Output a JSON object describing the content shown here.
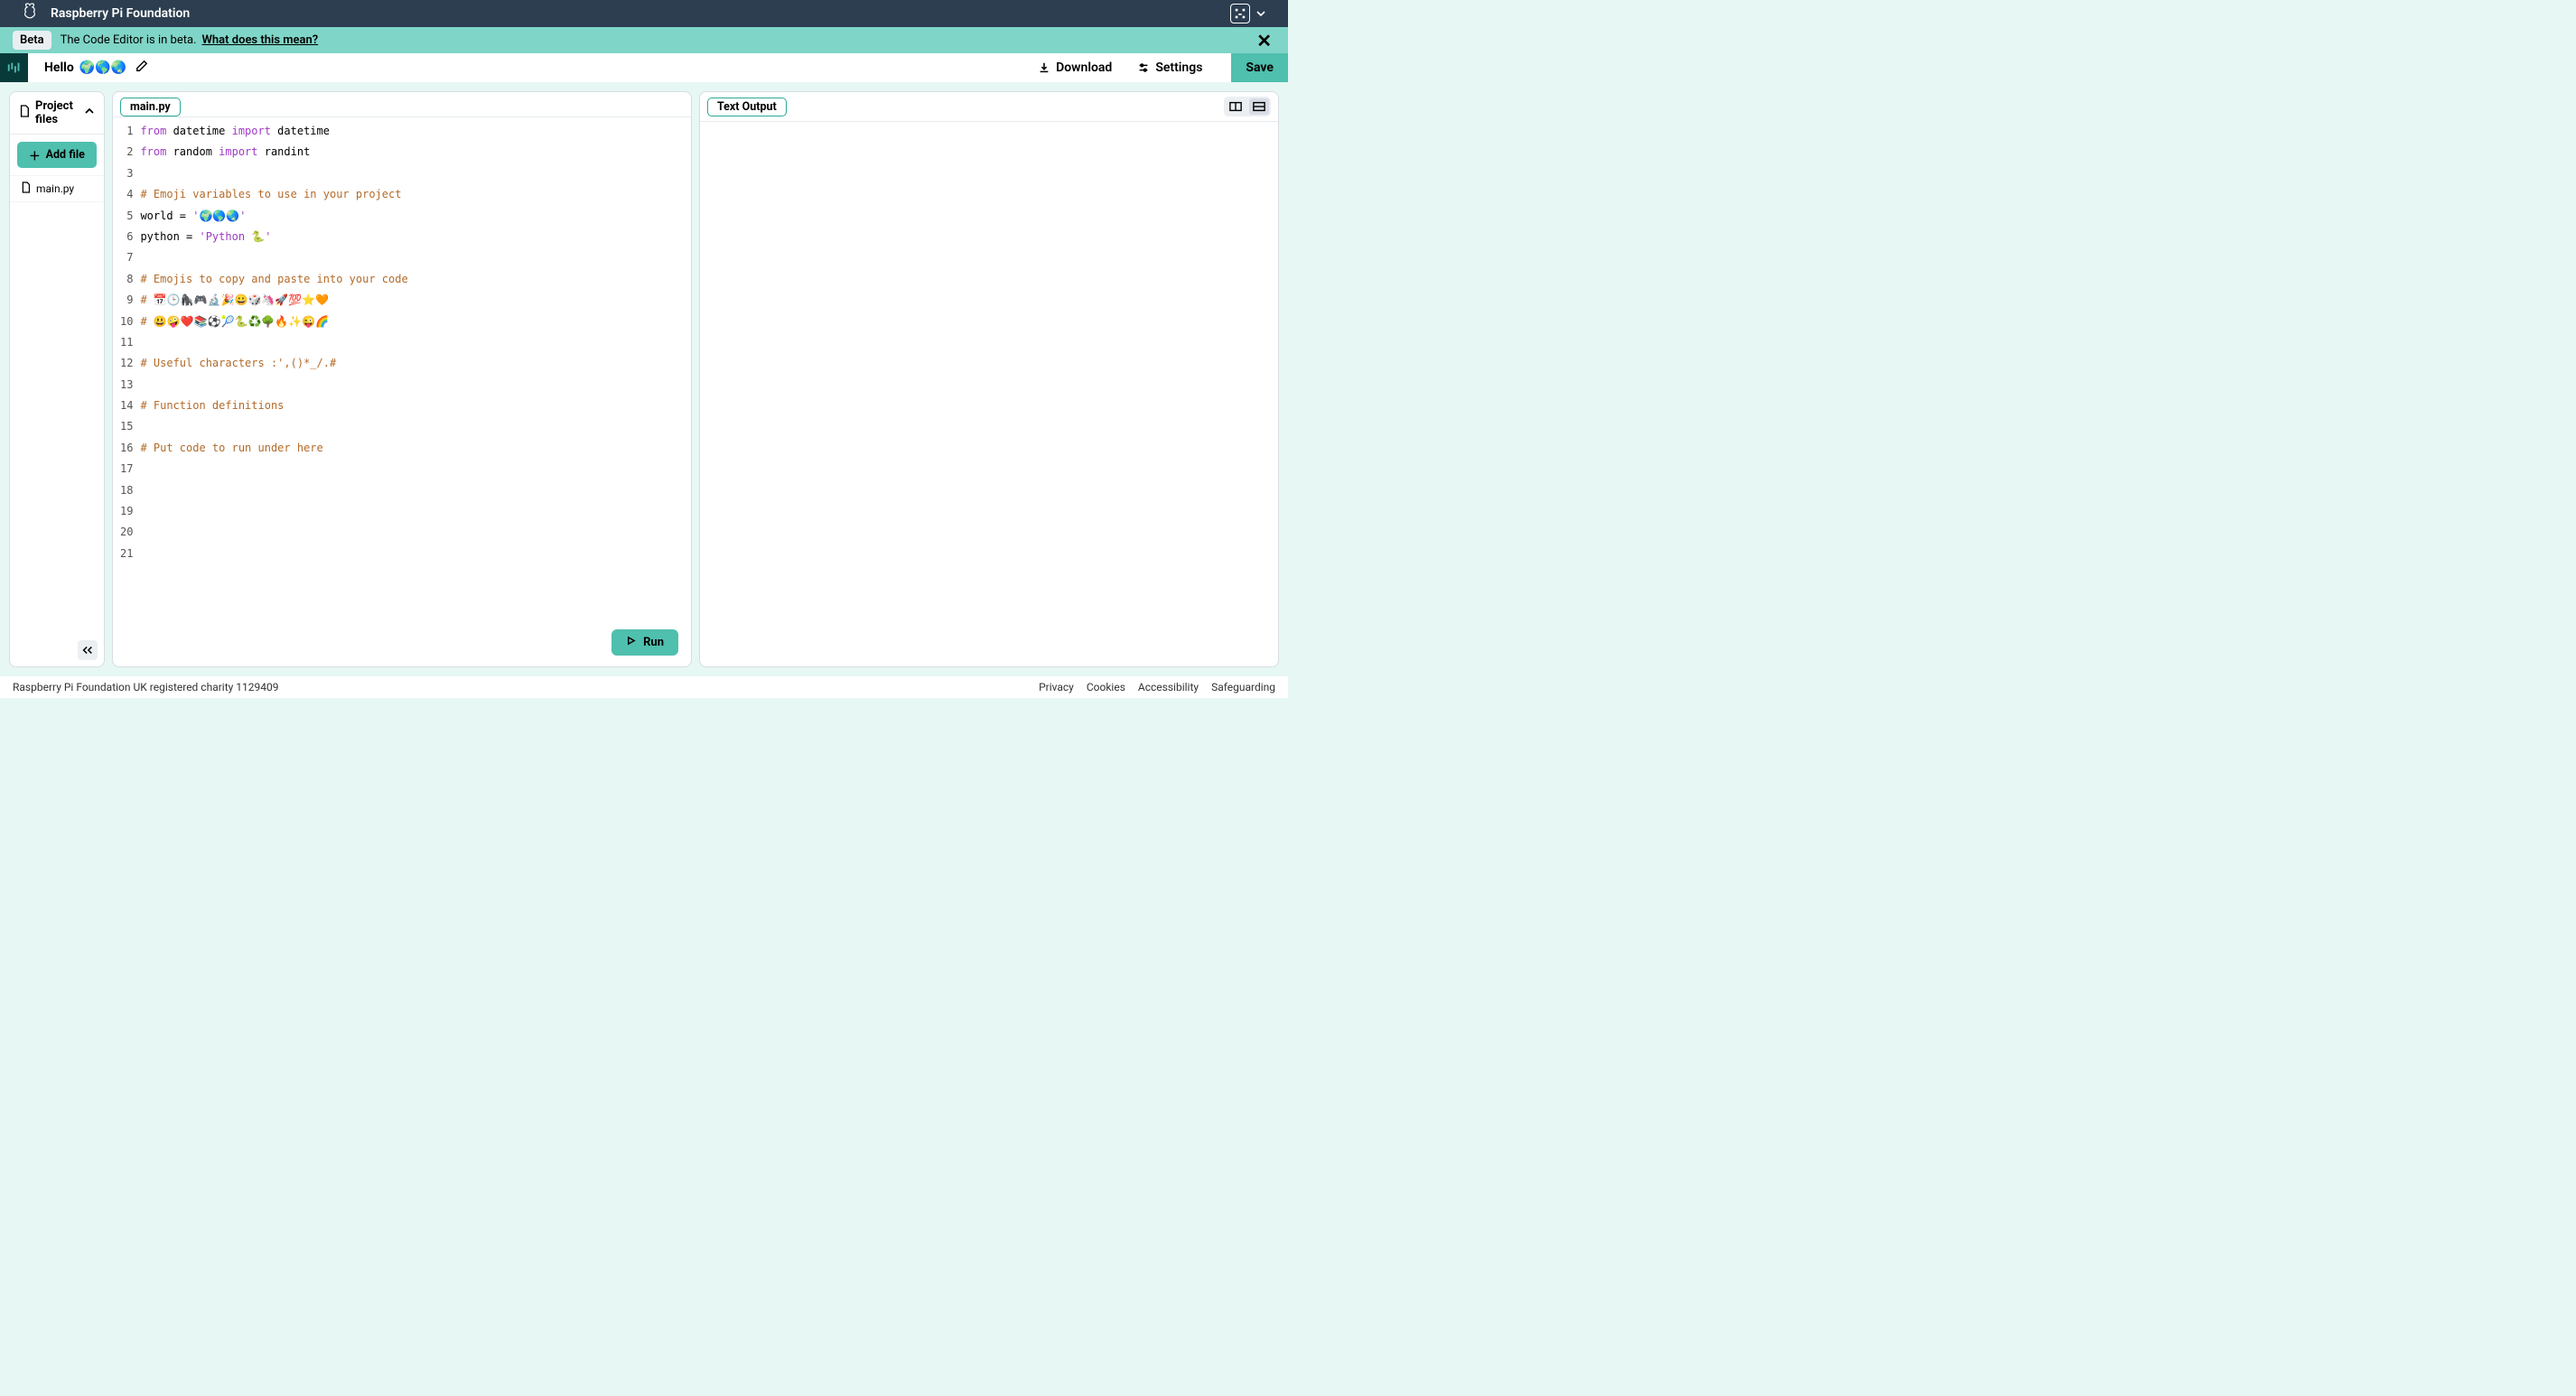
{
  "topbar": {
    "title": "Raspberry Pi Foundation"
  },
  "beta": {
    "badge": "Beta",
    "text": "The Code Editor is in beta.",
    "link": "What does this mean?"
  },
  "project": {
    "title_text": "Hello ",
    "title_emoji": "🌍🌎🌏",
    "download": "Download",
    "settings": "Settings",
    "save": "Save"
  },
  "sidebar": {
    "header": "Project files",
    "add_file": "Add file",
    "files": [
      {
        "name": "main.py"
      }
    ]
  },
  "editor": {
    "tab": "main.py",
    "run": "Run",
    "line_numbers": [
      "1",
      "2",
      "3",
      "4",
      "5",
      "6",
      "7",
      "8",
      "9",
      "10",
      "11",
      "12",
      "13",
      "14",
      "15",
      "16",
      "17",
      "18",
      "19",
      "20",
      "21"
    ],
    "code": [
      {
        "type": "line",
        "tokens": [
          {
            "t": "from ",
            "c": "kw"
          },
          {
            "t": "datetime",
            "c": ""
          },
          {
            "t": " import ",
            "c": "kw"
          },
          {
            "t": "datetime",
            "c": ""
          }
        ]
      },
      {
        "type": "line",
        "tokens": [
          {
            "t": "from ",
            "c": "kw"
          },
          {
            "t": "random",
            "c": ""
          },
          {
            "t": " import ",
            "c": "kw"
          },
          {
            "t": "randint",
            "c": ""
          }
        ]
      },
      {
        "type": "line",
        "tokens": []
      },
      {
        "type": "line",
        "tokens": [
          {
            "t": "# Emoji variables to use in your project",
            "c": "cm"
          }
        ]
      },
      {
        "type": "line",
        "tokens": [
          {
            "t": "world = ",
            "c": ""
          },
          {
            "t": "'🌍🌎🌏'",
            "c": "str"
          }
        ]
      },
      {
        "type": "line",
        "tokens": [
          {
            "t": "python = ",
            "c": ""
          },
          {
            "t": "'Python 🐍'",
            "c": "str"
          }
        ]
      },
      {
        "type": "line",
        "tokens": []
      },
      {
        "type": "line",
        "tokens": [
          {
            "t": "# Emojis to copy and paste into your code",
            "c": "cm"
          }
        ]
      },
      {
        "type": "line",
        "tokens": [
          {
            "t": "# 📅🕒🦍🎮🔬🎉😀🎲🦄🚀💯⭐🧡",
            "c": "cm"
          }
        ]
      },
      {
        "type": "line",
        "tokens": [
          {
            "t": "# 😃🤪❤️📚⚽🎾🐍♻️🌳🔥✨😜🌈",
            "c": "cm"
          }
        ]
      },
      {
        "type": "line",
        "tokens": []
      },
      {
        "type": "line",
        "tokens": [
          {
            "t": "# Useful characters :',()*_/.#",
            "c": "cm"
          }
        ]
      },
      {
        "type": "line",
        "tokens": []
      },
      {
        "type": "line",
        "tokens": [
          {
            "t": "# Function definitions",
            "c": "cm"
          }
        ]
      },
      {
        "type": "line",
        "tokens": []
      },
      {
        "type": "line",
        "tokens": [
          {
            "t": "# Put code to run under here",
            "c": "cm"
          }
        ]
      },
      {
        "type": "line",
        "tokens": []
      },
      {
        "type": "line",
        "tokens": []
      },
      {
        "type": "line",
        "tokens": []
      },
      {
        "type": "line",
        "tokens": []
      },
      {
        "type": "line",
        "tokens": []
      }
    ]
  },
  "output": {
    "tab": "Text Output"
  },
  "footer": {
    "charity": "Raspberry Pi Foundation UK registered charity 1129409",
    "links": [
      "Privacy",
      "Cookies",
      "Accessibility",
      "Safeguarding"
    ]
  }
}
